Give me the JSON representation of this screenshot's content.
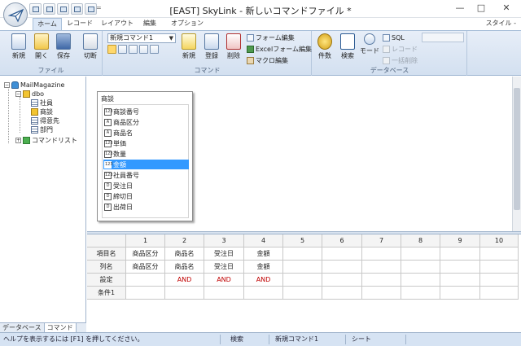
{
  "window": {
    "title": "[EAST] SkyLink - 新しいコマンドファイル *",
    "qat_more": "=",
    "controls": {
      "minimize": "—",
      "maximize": "□",
      "close": "✕"
    }
  },
  "tabs": [
    "ホーム",
    "レコード",
    "レイアウト",
    "編集",
    "オプション"
  ],
  "style_menu": "スタイル -",
  "ribbon": {
    "file_group": {
      "label": "ファイル",
      "buttons": [
        {
          "label": "新規",
          "icon": "new-file-icon"
        },
        {
          "label": "開く",
          "icon": "open-folder-icon"
        },
        {
          "label": "保存",
          "icon": "save-icon"
        },
        {
          "label": "切断",
          "icon": "disconnect-icon"
        }
      ]
    },
    "command_group": {
      "label": "コマンド",
      "selected_command": "新規コマンド1",
      "buttons": [
        {
          "label": "新規",
          "icon": "new-command-icon"
        },
        {
          "label": "登録",
          "icon": "register-icon"
        },
        {
          "label": "削除",
          "icon": "delete-icon"
        }
      ],
      "small": [
        {
          "label": "フォーム編集",
          "icon": "form-edit-icon"
        },
        {
          "label": "Excelフォーム編集",
          "icon": "excel-form-icon"
        },
        {
          "label": "マクロ編集",
          "icon": "macro-edit-icon"
        }
      ]
    },
    "database_group": {
      "label": "データベース",
      "buttons": [
        {
          "label": "件数",
          "icon": "count-icon"
        },
        {
          "label": "検索",
          "icon": "search-send-icon"
        },
        {
          "label": "モード",
          "icon": "mode-icon"
        }
      ],
      "small": [
        {
          "label": "SQL",
          "disabled": false
        },
        {
          "label": "レコード",
          "disabled": true
        },
        {
          "label": "一括削除",
          "disabled": true
        }
      ]
    }
  },
  "tree": {
    "root": "MailMagazine",
    "schema": "dbo",
    "tables": [
      "社員",
      "商談",
      "得意先",
      "部門"
    ],
    "commands": "コマンドリスト"
  },
  "panel_tabs": [
    "データベース",
    "コマンド"
  ],
  "table_box": {
    "title": "商談",
    "fields": [
      {
        "name": "商談番号",
        "type": "123",
        "selected": false
      },
      {
        "name": "商品区分",
        "type": "A",
        "selected": false
      },
      {
        "name": "商品名",
        "type": "A",
        "selected": false
      },
      {
        "name": "単価",
        "type": "123",
        "selected": false
      },
      {
        "name": "数量",
        "type": "123",
        "selected": false
      },
      {
        "name": "金額",
        "type": "123",
        "selected": true
      },
      {
        "name": "社員番号",
        "type": "123",
        "selected": false
      },
      {
        "name": "受注日",
        "type": "D",
        "selected": false
      },
      {
        "name": "締切日",
        "type": "D",
        "selected": false
      },
      {
        "name": "出荷日",
        "type": "D",
        "selected": false
      }
    ]
  },
  "grid": {
    "col_headers": [
      "1",
      "2",
      "3",
      "4",
      "5",
      "6",
      "7",
      "8",
      "9",
      "10"
    ],
    "rows": [
      {
        "label": "項目名",
        "cells": [
          "商品区分",
          "商品名",
          "受注日",
          "金額",
          "",
          "",
          "",
          "",
          "",
          ""
        ]
      },
      {
        "label": "列名",
        "cells": [
          "商品区分",
          "商品名",
          "受注日",
          "金額",
          "",
          "",
          "",
          "",
          "",
          ""
        ]
      },
      {
        "label": "設定",
        "cells": [
          "",
          "AND",
          "AND",
          "AND",
          "",
          "",
          "",
          "",
          "",
          ""
        ]
      },
      {
        "label": "条件1",
        "cells": [
          "",
          "",
          "",
          "",
          "",
          "",
          "",
          "",
          "",
          ""
        ]
      }
    ]
  },
  "status": {
    "help": "ヘルプを表示するには [F1] を押してください。",
    "mode": "検索",
    "command": "新規コマンド1",
    "sheet": "シート"
  },
  "colors": {
    "accent": "#3399ff",
    "and_text": "#c00000",
    "ribbon": "#dce6f3"
  }
}
